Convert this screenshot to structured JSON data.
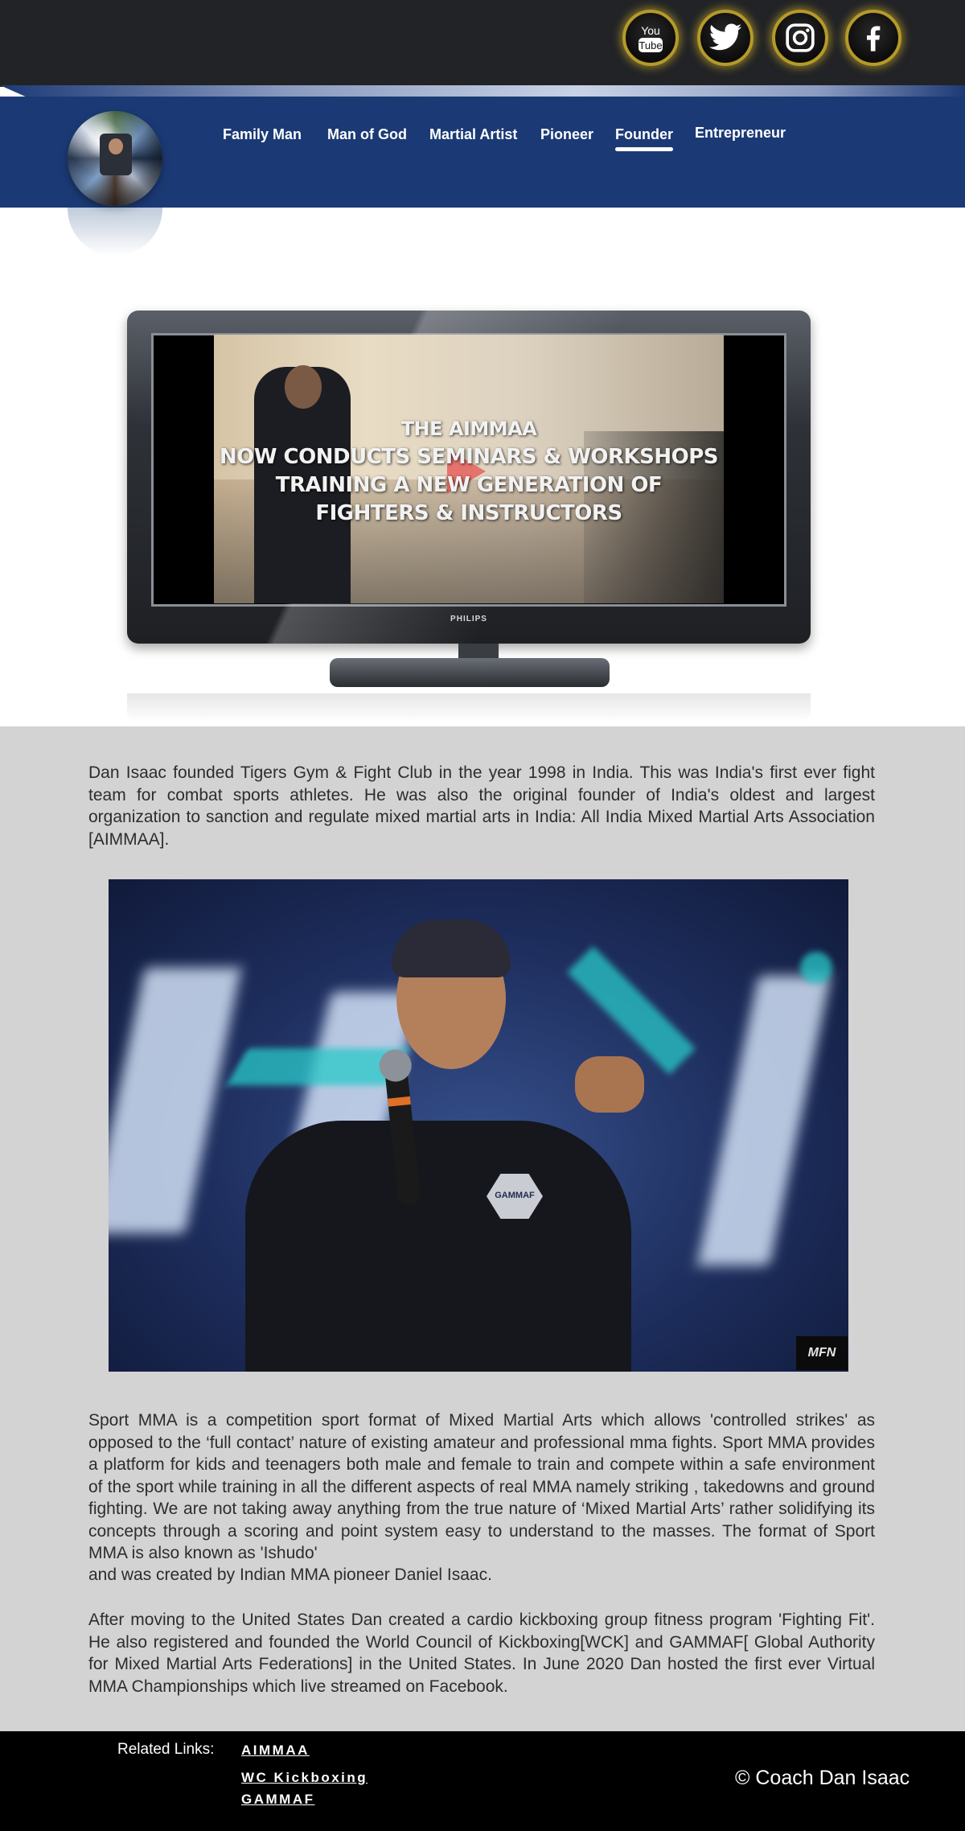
{
  "social": {
    "youtube_icon": "youtube-icon",
    "youtube_text_top": "You",
    "youtube_text_bottom": "Tube",
    "twitter_icon": "twitter-icon",
    "instagram_icon": "instagram-icon",
    "facebook_icon": "facebook-icon",
    "ring_color": "#b59a2a"
  },
  "nav": {
    "items": [
      {
        "label": "Family Man"
      },
      {
        "label": "Man of God"
      },
      {
        "label": "Martial Artist"
      },
      {
        "label": "Pioneer"
      },
      {
        "label": "Founder"
      },
      {
        "label": "Entrepreneur"
      }
    ],
    "active": "Founder",
    "band_color": "#1b3a75"
  },
  "video": {
    "overlay_lines": [
      "THE AIMMAA",
      "NOW CONDUCTS SEMINARS & WORKSHOPS",
      "TRAINING A NEW GENERATION OF",
      "FIGHTERS & INSTRUCTORS"
    ],
    "tv_brand": "PHILIPS"
  },
  "content": {
    "paragraph_1": "Dan Isaac founded Tigers Gym & Fight Club in the year 1998 in India. This was India's first ever fight team for combat sports athletes. He was also the original founder of India's oldest and largest organization to sanction and regulate mixed martial arts in India: All India Mixed Martial Arts Association [AIMMAA].",
    "photo_patch_text": "GAMMAF",
    "photo_logo_text": "MFN",
    "paragraph_2": "Sport MMA is a competition sport format of Mixed Martial Arts which allows 'controlled strikes' as opposed to the ‘full contact’ nature of existing amateur and professional mma fights. Sport MMA provides a platform for kids and teenagers both male and female to train and compete within a safe environment of the sport while training in all the different aspects of real MMA namely striking , takedowns and ground fighting. We are not taking away anything from the true nature of ‘Mixed Martial Arts’ rather solidifying its concepts through a scoring and point system easy to understand to the masses. The format of Sport MMA is also known as 'Ishudo'",
    "paragraph_2b": "and was created by Indian MMA pioneer Daniel Isaac.",
    "paragraph_3": "After moving to the United States Dan created a cardio kickboxing group fitness program 'Fighting Fit'. He also registered and founded the World Council of Kickboxing[WCK] and GAMMAF[ Global Authority for Mixed Martial Arts Federations] in the United States. In June 2020 Dan hosted the first ever Virtual MMA Championships which live streamed on Facebook.",
    "background_color": "#d3d3d3"
  },
  "footer": {
    "related_label": "Related Links:",
    "links": [
      {
        "label": "AIMMAA"
      },
      {
        "label": "WC Kickboxing"
      },
      {
        "label": "GAMMAF"
      }
    ],
    "copyright": "© Coach Dan Isaac"
  }
}
